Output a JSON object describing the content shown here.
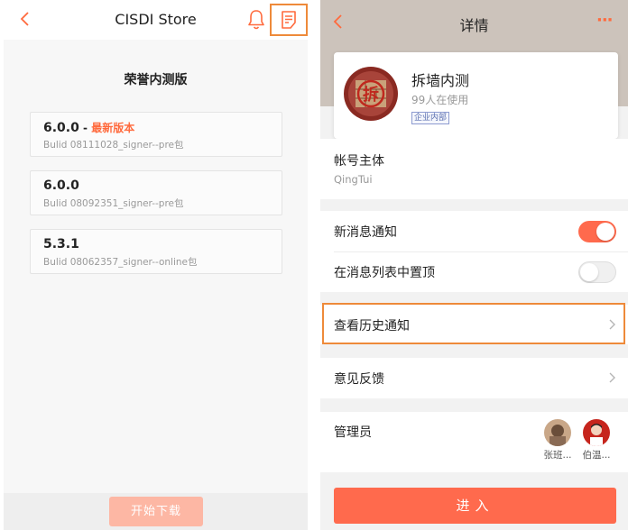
{
  "left_screen": {
    "header": {
      "title": "CISDI Store"
    },
    "section_title": "荣誉内测版",
    "versions": [
      {
        "version": "6.0.0",
        "separator": " - ",
        "tag": "最新版本",
        "build": "Bulid 08111028_signer--pre包"
      },
      {
        "version": "6.0.0",
        "separator": "",
        "tag": "",
        "build": "Bulid 08092351_signer--pre包"
      },
      {
        "version": "5.3.1",
        "separator": "",
        "tag": "",
        "build": "Bulid 08062357_signer--online包"
      }
    ],
    "download_label": "开始下载"
  },
  "right_screen": {
    "header": {
      "title": "详情",
      "more": "···"
    },
    "app": {
      "name": "拆墙内测",
      "users": "99人在使用",
      "badge": "企业内部",
      "logo_char": "拆"
    },
    "account": {
      "label": "帐号主体",
      "value": "QingTui"
    },
    "settings": [
      {
        "label": "新消息通知",
        "on": true
      },
      {
        "label": "在消息列表中置顶",
        "on": false
      }
    ],
    "history_label": "查看历史通知",
    "feedback_label": "意见反馈",
    "admins": {
      "label": "管理员",
      "people": [
        {
          "name": "张班..."
        },
        {
          "name": "伯温..."
        }
      ]
    },
    "enter_label": "进入"
  },
  "colors": {
    "accent": "#ff6a4d",
    "highlight": "#ee8a3a",
    "disabled_button": "#fdb7a4"
  }
}
